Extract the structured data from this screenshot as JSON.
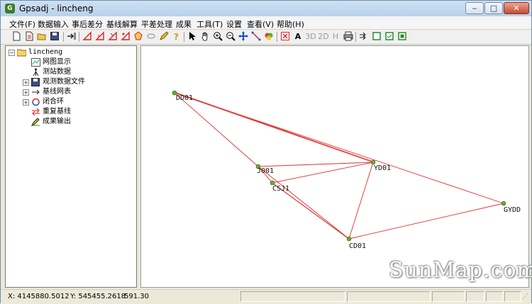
{
  "window": {
    "title": "Gpsadj - lincheng",
    "app_icon_text": "G"
  },
  "window_controls": {
    "minimize": "‒",
    "maximize": "□",
    "close": "✕"
  },
  "menu": [
    "文件(F)",
    "数据输入",
    "事后差分",
    "基线解算",
    "平差处理",
    "成果",
    "工具(T)",
    "设置",
    "查看(V)",
    "帮助(H)"
  ],
  "toolbar": {
    "text_tool": "A",
    "view_3d": "3D",
    "view_2d": "2D",
    "view_h": "H"
  },
  "tree": {
    "root": "lincheng",
    "items": [
      "网图显示",
      "测站数据",
      "观测数据文件",
      "基线网表",
      "闭合环",
      "重复基线",
      "成果输出"
    ]
  },
  "network": {
    "points": [
      {
        "name": "DD01"
      },
      {
        "name": "J001"
      },
      {
        "name": "CSJ1"
      },
      {
        "name": "YD01"
      },
      {
        "name": "GYDD"
      },
      {
        "name": "CD01"
      }
    ],
    "line_color": "#e03030",
    "point_color": "#6aa832"
  },
  "watermark": "SunMap.com",
  "status": {
    "x": "X: 4145880.5012",
    "y": "Y: 545455.2618",
    "z": "591.30"
  }
}
